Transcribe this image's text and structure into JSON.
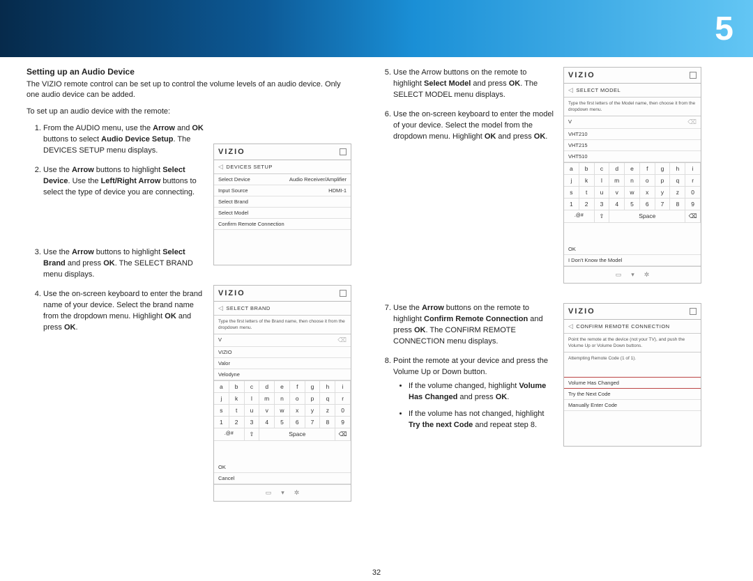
{
  "page": {
    "chapter": "5",
    "number": "32"
  },
  "section": {
    "title": "Setting up an Audio Device",
    "intro": "The VIZIO remote control can be set up to control the volume levels of an audio device. Only one audio device can be added.",
    "lead": "To set up an audio device with the remote:"
  },
  "steps": {
    "s1_a": "From the AUDIO menu, use the ",
    "s1_b": "Arrow",
    "s1_c": " and ",
    "s1_d": "OK",
    "s1_e": " buttons to select ",
    "s1_f": "Audio Device Setup",
    "s1_g": ". The DEVICES SETUP menu displays.",
    "s2_a": "Use the ",
    "s2_b": "Arrow",
    "s2_c": " buttons to highlight ",
    "s2_d": "Select Device",
    "s2_e": ". Use the ",
    "s2_f": "Left/Right Arrow",
    "s2_g": " buttons to select the type of device you are connecting.",
    "s3_a": "Use the ",
    "s3_b": "Arrow",
    "s3_c": " buttons to highlight ",
    "s3_d": "Select Brand",
    "s3_e": " and press ",
    "s3_f": "OK",
    "s3_g": ". The SELECT BRAND menu displays.",
    "s4_a": "Use the on-screen keyboard to enter the brand name of your device. Select the brand name from the dropdown menu. Highlight ",
    "s4_b": "OK",
    "s4_c": " and press ",
    "s4_d": "OK",
    "s4_e": ".",
    "s5_a": "Use the Arrow buttons on the remote to highlight ",
    "s5_b": "Select Model",
    "s5_c": " and press ",
    "s5_d": "OK",
    "s5_e": ". The SELECT MODEL menu displays.",
    "s6_a": "Use the on-screen keyboard to enter the model of your device. Select the model from the dropdown menu. Highlight ",
    "s6_b": "OK",
    "s6_c": " and press ",
    "s6_d": "OK",
    "s6_e": ".",
    "s7_a": "Use the ",
    "s7_b": "Arrow",
    "s7_c": " buttons on the remote to highlight ",
    "s7_d": "Confirm Remote Connection",
    "s7_e": " and press ",
    "s7_f": "OK",
    "s7_g": ". The CONFIRM REMOTE CONNECTION menu displays.",
    "s8": "Point the remote at your device and press the Volume Up or Down button.",
    "b1_a": "If the volume changed, highlight ",
    "b1_b": "Volume Has Changed",
    "b1_c": " and press ",
    "b1_d": "OK",
    "b1_e": ".",
    "b2_a": "If the volume has not changed, highlight ",
    "b2_b": "Try the next Code",
    "b2_c": " and repeat step 8."
  },
  "osd1": {
    "brand": "VIZIO",
    "crumb": "DEVICES SETUP",
    "r1l": "Select Device",
    "r1r": "Audio Receiver/Amplifier",
    "r2l": "Input Source",
    "r2r": "HDMI-1",
    "r3": "Select Brand",
    "r4": "Select Model",
    "r5": "Confirm Remote Connection"
  },
  "osd2": {
    "brand": "VIZIO",
    "crumb": "SELECT BRAND",
    "instr": "Type the first letters of the Brand name, then choose it from the dropdown menu.",
    "input": "V",
    "l1": "VIZIO",
    "l2": "Valor",
    "l3": "Velodyne",
    "ok": "OK",
    "cancel": "Cancel"
  },
  "osd3": {
    "brand": "VIZIO",
    "crumb": "SELECT MODEL",
    "instr": "Type the first letters of the Model name, then choose it from the dropdown menu.",
    "input": "V",
    "l1": "VHT210",
    "l2": "VHT215",
    "l3": "VHT510",
    "ok": "OK",
    "idk": "I Don't Know the Model"
  },
  "osd4": {
    "brand": "VIZIO",
    "crumb": "CONFIRM REMOTE CONNECTION",
    "instr": "Point the remote at the device (not your TV), and push the Volume Up or Volume Down buttons.",
    "status": "Attempting Remote Code (1 of 1).",
    "r1": "Volume Has Changed",
    "r2": "Try the Next Code",
    "r3": "Manually Enter Code"
  },
  "kbd": {
    "rows": [
      [
        "a",
        "b",
        "c",
        "d",
        "e",
        "f",
        "g",
        "h",
        "i"
      ],
      [
        "j",
        "k",
        "l",
        "m",
        "n",
        "o",
        "p",
        "q",
        "r"
      ],
      [
        "s",
        "t",
        "u",
        "v",
        "w",
        "x",
        "y",
        "z",
        "0"
      ],
      [
        "1",
        "2",
        "3",
        "4",
        "5",
        "6",
        "7",
        "8",
        "9"
      ]
    ],
    "sym": ".@#",
    "shift": "⇧",
    "space": "Space",
    "del": "⌫"
  },
  "footer": {
    "i1": "▭",
    "i2": "▾",
    "i3": "✲"
  }
}
